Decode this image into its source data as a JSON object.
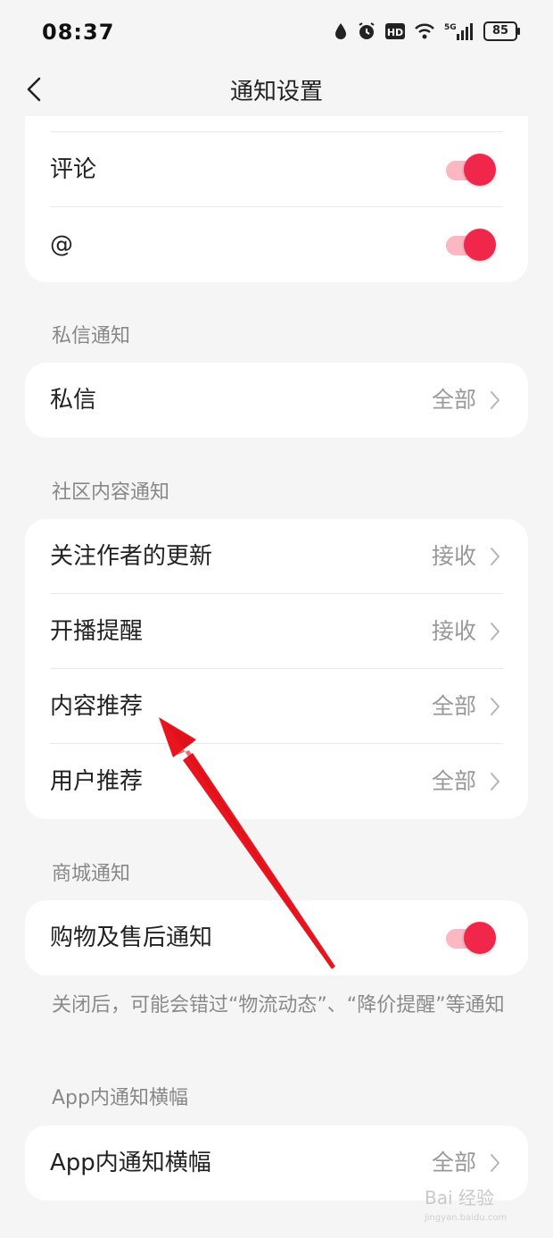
{
  "status_bar": {
    "time": "08:37",
    "battery": "85"
  },
  "header": {
    "title": "通知设置"
  },
  "interaction_card": {
    "rows": [
      {
        "label": "评论",
        "toggle": true
      },
      {
        "label": "@",
        "toggle": true
      }
    ]
  },
  "dm_section": {
    "title": "私信通知",
    "rows": [
      {
        "label": "私信",
        "value": "全部"
      }
    ]
  },
  "community_section": {
    "title": "社区内容通知",
    "rows": [
      {
        "label": "关注作者的更新",
        "value": "接收"
      },
      {
        "label": "开播提醒",
        "value": "接收"
      },
      {
        "label": "内容推荐",
        "value": "全部"
      },
      {
        "label": "用户推荐",
        "value": "全部"
      }
    ]
  },
  "mall_section": {
    "title": "商城通知",
    "rows": [
      {
        "label": "购物及售后通知",
        "toggle": true
      }
    ],
    "note": "关闭后，可能会错过“物流动态”、“降价提醒”等通知"
  },
  "banner_section": {
    "title": "App内通知横幅",
    "rows": [
      {
        "label": "App内通知横幅",
        "value": "全部"
      }
    ]
  },
  "watermark": {
    "text": "Bai 经验",
    "subtext": "jingyan.baidu.com"
  },
  "colors": {
    "accent": "#f0264a",
    "toggle_track": "#fbb7c2",
    "annotation_arrow": "#e8141e"
  }
}
